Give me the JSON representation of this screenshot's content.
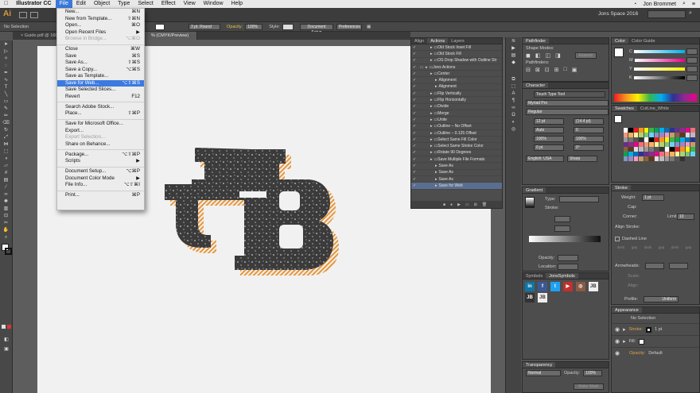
{
  "menubar": {
    "apple": "",
    "app": "Illustrator CC",
    "items": [
      "File",
      "Edit",
      "Object",
      "Type",
      "Select",
      "Effect",
      "View",
      "Window",
      "Help"
    ],
    "user": "Jon Brommet"
  },
  "appbar": {
    "logo": "Ai",
    "workspace": "Jons Space 2016"
  },
  "control": {
    "selection": "No Selection",
    "stroke_weight": "3 pt. Round",
    "opacity_label": "Opacity:",
    "opacity": "100%",
    "style_label": "Style:",
    "doc_setup": "Document Setup",
    "preferences": "Preferences"
  },
  "tabs": [
    {
      "label": "Guide.pdf @ 160..."
    },
    {
      "label": "% (CMYK/Preview)"
    }
  ],
  "filemenu": [
    {
      "label": "New...",
      "shortcut": "⌘N"
    },
    {
      "label": "New from Template...",
      "shortcut": "⇧⌘N"
    },
    {
      "label": "Open...",
      "shortcut": "⌘O"
    },
    {
      "label": "Open Recent Files",
      "shortcut": "▶"
    },
    {
      "label": "Browse in Bridge...",
      "shortcut": "⌥⌘O",
      "disabled": true
    },
    {
      "sep": true
    },
    {
      "label": "Close",
      "shortcut": "⌘W"
    },
    {
      "label": "Save",
      "shortcut": "⌘S"
    },
    {
      "label": "Save As...",
      "shortcut": "⇧⌘S"
    },
    {
      "label": "Save a Copy...",
      "shortcut": "⌥⌘S"
    },
    {
      "label": "Save as Template...",
      "shortcut": ""
    },
    {
      "label": "Save for Web...",
      "shortcut": "⌥⇧⌘S",
      "highlight": true
    },
    {
      "label": "Save Selected Slices...",
      "shortcut": ""
    },
    {
      "label": "Revert",
      "shortcut": "F12"
    },
    {
      "sep": true
    },
    {
      "label": "Search Adobe Stock...",
      "shortcut": ""
    },
    {
      "label": "Place...",
      "shortcut": "⇧⌘P"
    },
    {
      "sep": true
    },
    {
      "label": "Save for Microsoft Office...",
      "shortcut": ""
    },
    {
      "label": "Export...",
      "shortcut": ""
    },
    {
      "label": "Export Selection...",
      "shortcut": "",
      "disabled": true
    },
    {
      "label": "Share on Behance...",
      "shortcut": ""
    },
    {
      "sep": true
    },
    {
      "label": "Package...",
      "shortcut": "⌥⇧⌘P"
    },
    {
      "label": "Scripts",
      "shortcut": "▶"
    },
    {
      "sep": true
    },
    {
      "label": "Document Setup...",
      "shortcut": "⌥⌘P"
    },
    {
      "label": "Document Color Mode",
      "shortcut": "▶"
    },
    {
      "label": "File Info...",
      "shortcut": "⌥⇧⌘I"
    },
    {
      "sep": true
    },
    {
      "label": "Print...",
      "shortcut": "⌘P"
    }
  ],
  "actions": {
    "tabs": [
      "Align",
      "Actions",
      "Layers"
    ],
    "rows": [
      {
        "label": "Old Stock Inset Fill",
        "indent": 1
      },
      {
        "label": "Old Stock Fill",
        "indent": 1
      },
      {
        "label": "OS Drop Shadow with Outline Str",
        "indent": 1
      },
      {
        "label": "Jons Actions",
        "indent": 0
      },
      {
        "label": "Center",
        "indent": 1
      },
      {
        "label": "Alignment",
        "indent": 2
      },
      {
        "label": "Alignment",
        "indent": 2
      },
      {
        "label": "Flip Vertically",
        "indent": 1
      },
      {
        "label": "Flip Horizontally",
        "indent": 1
      },
      {
        "label": "Divide",
        "indent": 1
      },
      {
        "label": "Merge",
        "indent": 1
      },
      {
        "label": "Unite",
        "indent": 1
      },
      {
        "label": "Outline – No Offset",
        "indent": 1
      },
      {
        "label": "Outline – 0.125 Offset",
        "indent": 1
      },
      {
        "label": "Select Same Fill Color",
        "indent": 1
      },
      {
        "label": "Select Same Stroke Color",
        "indent": 1
      },
      {
        "label": "Rotate 90 Degrees",
        "indent": 1
      },
      {
        "label": "Save Multiple File Formats",
        "indent": 1
      },
      {
        "label": "Save As",
        "indent": 2
      },
      {
        "label": "Save As",
        "indent": 2
      },
      {
        "label": "Save As",
        "indent": 2
      },
      {
        "label": "Save for Web",
        "indent": 2,
        "highlight": true
      }
    ]
  },
  "pathfinder": {
    "tabs": [
      "Pathfinder"
    ],
    "shape_modes": "Shape Modes:",
    "expand": "Expand",
    "pathfinders": "Pathfinders:"
  },
  "character": {
    "tabs": [
      "Character"
    ],
    "touch_type": "Touch Type Tool",
    "font": "Myriad Pro",
    "style": "Regular",
    "size": "12 pt",
    "leading": "(14.4 pt)",
    "kerning": "Auto",
    "tracking": "0",
    "hscale": "100%",
    "vscale": "100%",
    "baseline": "0 pt",
    "rotate": "0°",
    "language": "English: USA",
    "aa": "Sharp"
  },
  "gradient": {
    "tabs": [
      "Gradient"
    ],
    "type_label": "Type:",
    "stroke_label": "Stroke:",
    "opacity_label": "Opacity:",
    "location_label": "Location:"
  },
  "symbols": {
    "tabs": [
      "Symbols",
      "JonsSymbols"
    ]
  },
  "transparency": {
    "tabs": [
      "Transparency"
    ],
    "mode": "Normal",
    "opacity_label": "Opacity:",
    "opacity": "100%",
    "make_mask": "Make Mask"
  },
  "color": {
    "tabs": [
      "Color",
      "Color Guide"
    ],
    "labels": [
      "C",
      "M",
      "Y",
      "K"
    ]
  },
  "swatches": {
    "tabs": [
      "Swatches",
      "CutLine_White"
    ]
  },
  "stroke": {
    "tabs": [
      "Stroke"
    ],
    "weight_label": "Weight:",
    "weight": "1 pt",
    "cap": "Cap:",
    "corner": "Corner:",
    "limit_label": "Limit:",
    "limit": "10",
    "align": "Align Stroke:",
    "dashed": "Dashed Line",
    "dash_labels": [
      "dash",
      "gap",
      "dash",
      "gap",
      "dash",
      "gap"
    ],
    "arrowheads": "Arrowheads:",
    "scale": "Scale:",
    "align2": "Align:",
    "profile": "Profile:",
    "profile_val": "Uniform"
  },
  "appearance": {
    "tabs": [
      "Appearance"
    ],
    "title": "No Selection",
    "stroke": "Stroke:",
    "stroke_val": "1 pt",
    "fill": "Fill:",
    "opacity": "Opacity:",
    "opacity_val": "Default"
  },
  "colors": {
    "accent": "#3d7ae0",
    "logo": "#3b3b3b",
    "shadow": "#e89638",
    "artboard": "#f1f1f1"
  }
}
